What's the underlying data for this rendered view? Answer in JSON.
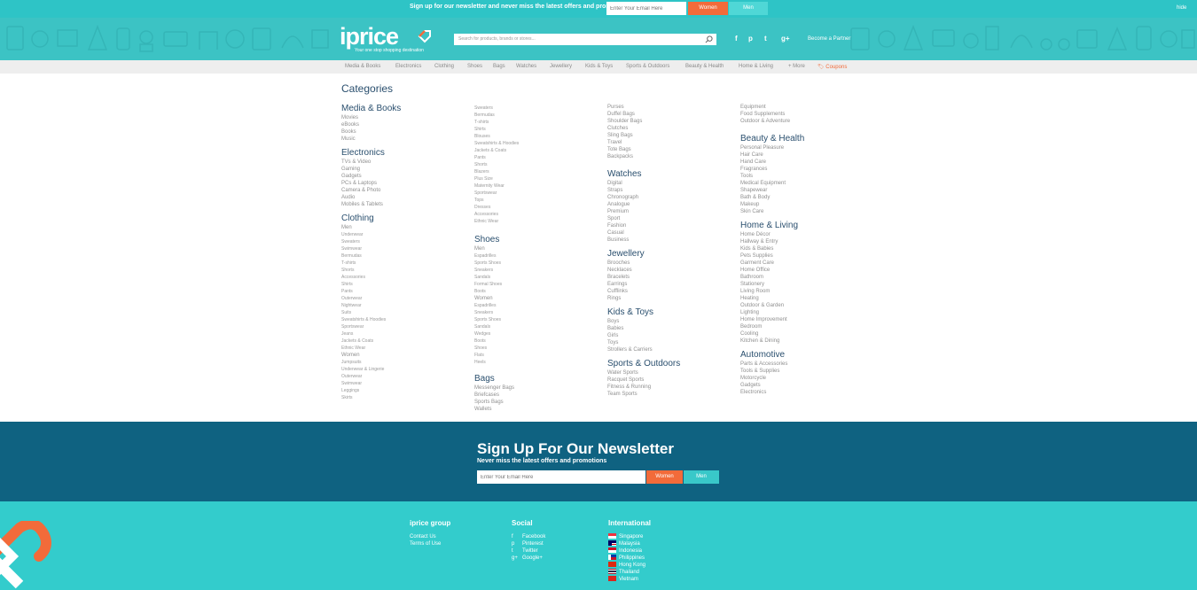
{
  "topbar": {
    "message": "Sign up for our newsletter and never miss the latest offers and promotions:",
    "email_placeholder": "Enter Your Email Here",
    "women_label": "Women",
    "men_label": "Men",
    "hide_label": "hide"
  },
  "header": {
    "logo_text": "iprice",
    "tagline": "Your one stop shopping destination",
    "search_placeholder": "Search for products, brands or stores...",
    "social": [
      "f",
      "p",
      "t",
      "g+"
    ],
    "partner_label": "Become a Partner"
  },
  "nav": {
    "items": [
      "Media & Books",
      "Electronics",
      "Clothing",
      "Shoes",
      "Bags",
      "Watches",
      "Jewellery",
      "Kids & Toys",
      "Sports & Outdoors",
      "Beauty & Health",
      "Home & Living",
      "+ More"
    ],
    "coupons_label": "Coupons"
  },
  "categories": {
    "title": "Categories",
    "media_books": {
      "heading": "Media & Books",
      "items": [
        "Movies",
        "eBooks",
        "Books",
        "Music"
      ]
    },
    "electronics": {
      "heading": "Electronics",
      "items": [
        "TVs & Video",
        "Gaming",
        "Gadgets",
        "PCs & Laptops",
        "Camera & Photo",
        "Audio",
        "Mobiles & Tablets"
      ]
    },
    "clothing": {
      "heading": "Clothing",
      "men_label": "Men",
      "men_items": [
        "Underwear",
        "Sweaters",
        "Swimwear",
        "Bermudas",
        "T-shirts",
        "Shorts",
        "Accessories",
        "Shirts",
        "Pants",
        "Outerwear",
        "Nightwear",
        "Suits",
        "Sweatshirts & Hoodies",
        "Sportswear",
        "Jeans",
        "Jackets & Coats",
        "Ethnic Wear"
      ],
      "women_label": "Women",
      "women_items": [
        "Jumpsuits",
        "Underwear & Lingerie",
        "Outerwear",
        "Swimwear",
        "Leggings",
        "Skirts"
      ],
      "women_items_col2": [
        "Sweaters",
        "Bermudas",
        "T-shirts",
        "Shirts",
        "Blouses",
        "Sweatshirts & Hoodies",
        "Jackets & Coats",
        "Pants",
        "Shorts",
        "Blazers",
        "Plus Size",
        "Maternity Wear",
        "Sportswear",
        "Tops",
        "Dresses",
        "Accessories",
        "Ethnic Wear"
      ]
    },
    "shoes": {
      "heading": "Shoes",
      "men_label": "Men",
      "men_items": [
        "Espadrilles",
        "Sports Shoes",
        "Sneakers",
        "Sandals",
        "Formal Shoes",
        "Boots"
      ],
      "women_label": "Women",
      "women_items": [
        "Espadrilles",
        "Sneakers",
        "Sports Shoes",
        "Sandals",
        "Wedges",
        "Boots",
        "Shoes",
        "Flats",
        "Heels"
      ]
    },
    "bags": {
      "heading": "Bags",
      "items": [
        "Messenger Bags",
        "Briefcases",
        "Sports Bags",
        "Wallets",
        "Purses",
        "Duffel Bags",
        "Shoulder Bags",
        "Clutches",
        "Sling Bags",
        "Travel",
        "Tote Bags",
        "Backpacks"
      ]
    },
    "watches": {
      "heading": "Watches",
      "items": [
        "Digital",
        "Straps",
        "Chronograph",
        "Analogue",
        "Premium",
        "Sport",
        "Fashion",
        "Casual",
        "Business"
      ]
    },
    "jewellery": {
      "heading": "Jewellery",
      "items": [
        "Brooches",
        "Necklaces",
        "Bracelets",
        "Earrings",
        "Cufflinks",
        "Rings"
      ]
    },
    "kids_toys": {
      "heading": "Kids & Toys",
      "items": [
        "Boys",
        "Babies",
        "Girls",
        "Toys",
        "Strollers & Carriers"
      ]
    },
    "sports": {
      "heading": "Sports & Outdoors",
      "items": [
        "Water Sports",
        "Racquet Sports",
        "Fitness & Running",
        "Team Sports",
        "Equipment",
        "Food Supplements",
        "Outdoor & Adventure"
      ]
    },
    "beauty": {
      "heading": "Beauty & Health",
      "items": [
        "Personal Pleasure",
        "Hair Care",
        "Hand Care",
        "Fragrances",
        "Tools",
        "Medical Equipment",
        "Shapewear",
        "Bath & Body",
        "Makeup",
        "Skin Care"
      ]
    },
    "home": {
      "heading": "Home & Living",
      "items": [
        "Home Décor",
        "Hallway & Entry",
        "Kids & Babies",
        "Pets Supplies",
        "Garment Care",
        "Home Office",
        "Bathroom",
        "Stationery",
        "Living Room",
        "Heating",
        "Outdoor & Garden",
        "Lighting",
        "Home Improvement",
        "Bedroom",
        "Cooling",
        "Kitchen & Dining"
      ]
    },
    "automotive": {
      "heading": "Automotive",
      "items": [
        "Parts & Accessories",
        "Tools & Supplies",
        "Motorcycle",
        "Gadgets",
        "Electronics"
      ]
    }
  },
  "newsletter": {
    "title": "Sign Up For Our Newsletter",
    "subtitle": "Never miss the latest offers and promotions",
    "email_placeholder": "Enter Your Email Here",
    "women_label": "Women",
    "men_label": "Men"
  },
  "footer": {
    "group_heading": "iprice group",
    "group_links": [
      "Contact Us",
      "Terms of Use"
    ],
    "social_heading": "Social",
    "social_links": [
      "Facebook",
      "Pinterest",
      "Twitter",
      "Google+"
    ],
    "intl_heading": "International",
    "countries": [
      "Singapore",
      "Malaysia",
      "Indonesia",
      "Philippines",
      "Hong Kong",
      "Thailand",
      "Vietnam"
    ]
  },
  "colors": {
    "teal": "#3cc3c4",
    "navy": "#0f6281",
    "orange": "#f26b3a",
    "heading": "#2a4f6e"
  }
}
